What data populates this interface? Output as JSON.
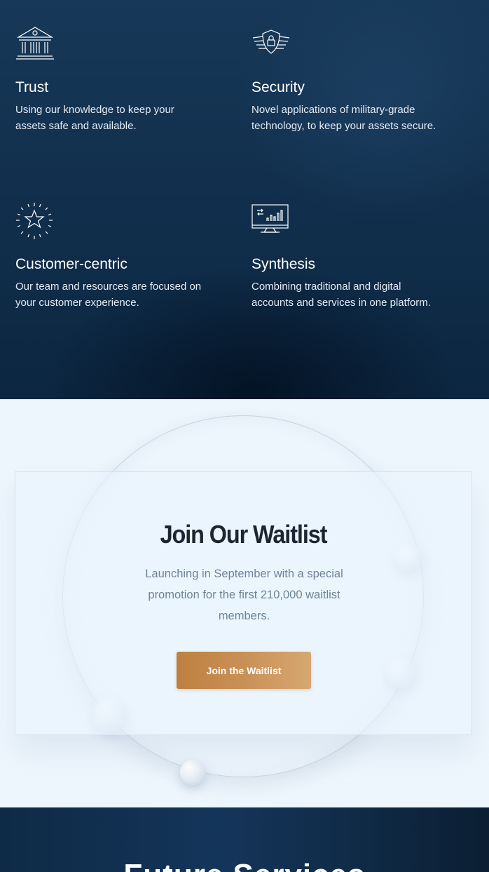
{
  "features": [
    {
      "id": "trust",
      "icon": "bank-icon",
      "title": "Trust",
      "description": "Using our knowledge to keep your assets safe and available."
    },
    {
      "id": "security",
      "icon": "shield-lock-icon",
      "title": "Security",
      "description": "Novel applications of military-grade technology, to keep your assets secure."
    },
    {
      "id": "customer",
      "icon": "star-icon",
      "title": "Customer-centric",
      "description": "Our team and resources are focused on your customer experience."
    },
    {
      "id": "synthesis",
      "icon": "monitor-chart-icon",
      "title": "Synthesis",
      "description": "Combining traditional and digital accounts and services in one platform."
    }
  ],
  "waitlist": {
    "title": "Join Our Waitlist",
    "description": "Launching in September with a special promotion for the first 210,000 waitlist members.",
    "button_label": "Join the Waitlist"
  },
  "next_section": {
    "title": "Future Services"
  },
  "colors": {
    "dark_navy": "#12314f",
    "light_bg": "#eef6fd",
    "gold_start": "#bd8040",
    "gold_end": "#d6a872"
  }
}
